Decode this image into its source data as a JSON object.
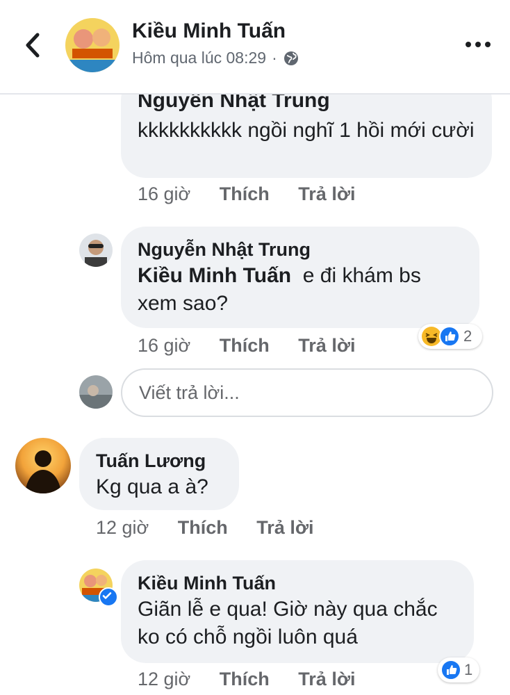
{
  "header": {
    "name": "Kiều Minh Tuấn",
    "timestamp": "Hôm qua lúc 08:29",
    "separator": "·",
    "back_icon": "chevron-left-icon",
    "privacy_icon": "globe-icon",
    "more_icon": "more-horizontal-icon"
  },
  "comments": [
    {
      "author": "Nguyễn Nhật Trung",
      "text": "kkkkkkkkkk ngồi nghĩ 1 hồi mới cười",
      "time": "16 giờ",
      "like": "Thích",
      "reply": "Trả lời"
    },
    {
      "author": "Nguyễn Nhật Trung",
      "mention": "Kiều Minh Tuấn",
      "text": "e đi khám bs xem sao?",
      "time": "16 giờ",
      "like": "Thích",
      "reply": "Trả lời",
      "reactions": {
        "icons": [
          "haha-icon",
          "like-icon"
        ],
        "count": "2"
      }
    },
    {
      "author": "Tuấn Lương",
      "text": "Kg qua a à?",
      "time": "12 giờ",
      "like": "Thích",
      "reply": "Trả lời"
    },
    {
      "author": "Kiều Minh Tuấn",
      "text": "Giãn lễ e qua! Giờ này qua chắc ko có chỗ ngồi luôn quá",
      "time": "12 giờ",
      "like": "Thích",
      "reply": "Trả lời",
      "verified_icon": "verified-badge-icon",
      "reactions": {
        "icons": [
          "like-icon"
        ],
        "count": "1"
      }
    }
  ],
  "reply_input": {
    "placeholder": "Viết trả lời..."
  },
  "colors": {
    "bubble": "#f0f2f5",
    "meta": "#65676b",
    "like_blue": "#1877f2",
    "haha_yellow": "#f7b928"
  }
}
